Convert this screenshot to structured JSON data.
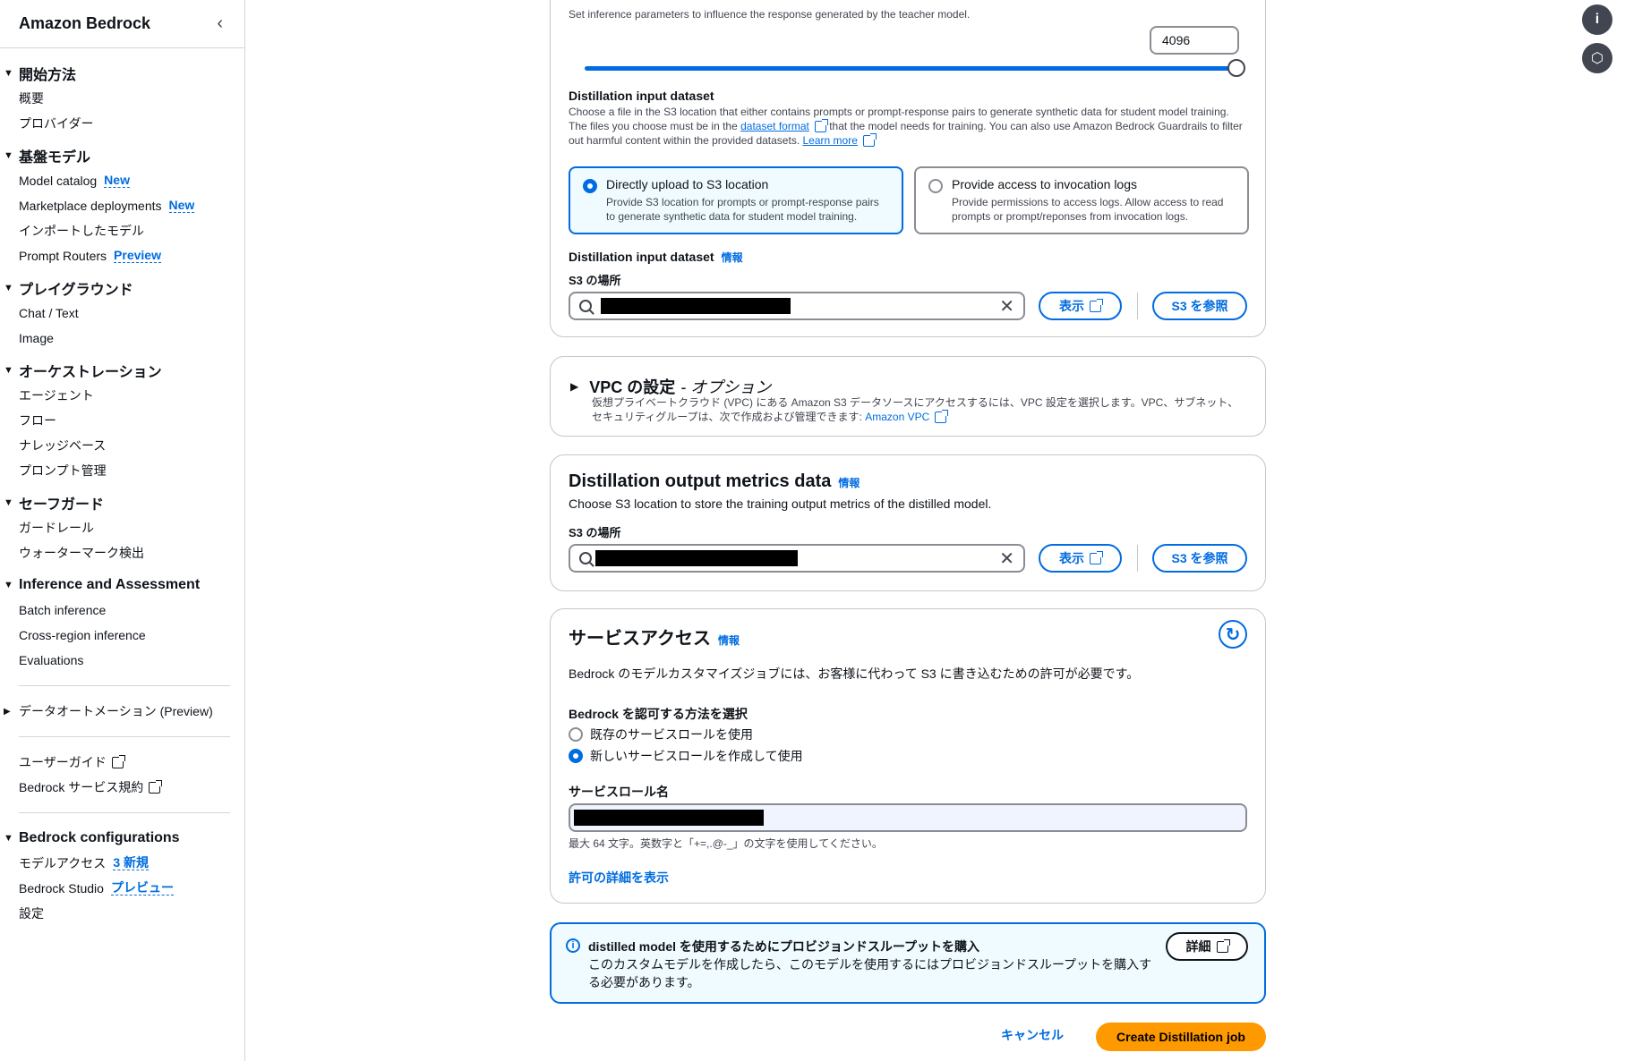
{
  "sidebar": {
    "title": "Amazon Bedrock",
    "sections": [
      {
        "title": "開始方法",
        "items": [
          {
            "label": "概要"
          },
          {
            "label": "プロバイダー"
          }
        ]
      },
      {
        "title": "基盤モデル",
        "items": [
          {
            "label": "Model catalog",
            "badge": "New"
          },
          {
            "label": "Marketplace deployments",
            "badge": "New"
          },
          {
            "label": "インポートしたモデル"
          },
          {
            "label": "Prompt Routers",
            "badge": "Preview"
          }
        ]
      },
      {
        "title": "プレイグラウンド",
        "items": [
          {
            "label": "Chat / Text"
          },
          {
            "label": "Image"
          }
        ]
      },
      {
        "title": "オーケストレーション",
        "items": [
          {
            "label": "エージェント"
          },
          {
            "label": "フロー"
          },
          {
            "label": "ナレッジベース"
          },
          {
            "label": "プロンプト管理"
          }
        ]
      },
      {
        "title": "セーフガード",
        "items": [
          {
            "label": "ガードレール"
          },
          {
            "label": "ウォーターマーク検出"
          }
        ]
      },
      {
        "title": "Inference and Assessment",
        "items": [
          {
            "label": "Batch inference"
          },
          {
            "label": "Cross-region inference"
          },
          {
            "label": "Evaluations"
          }
        ]
      }
    ],
    "data_automation": "データオートメーション (Preview)",
    "user_guide": "ユーザーガイド",
    "terms": "Bedrock サービス規約",
    "config": {
      "title": "Bedrock configurations",
      "model_access": "モデルアクセス",
      "model_access_badge": "3 新規",
      "studio": "Bedrock Studio",
      "studio_badge": "プレビュー",
      "settings": "設定"
    }
  },
  "top_card": {
    "desc": "Set inference parameters to influence the response generated by the teacher model.",
    "max_value": "4096",
    "slider_fraction": 1.0,
    "dataset_title": "Distillation input dataset",
    "dataset_desc_1": "Choose a file in the S3 location that either contains prompts or prompt-response pairs to generate synthetic data for student model training. The files you choose must be in the",
    "dataset_format_link": "dataset format",
    "dataset_desc_2": "that the model needs for training. You can also use Amazon Bedrock Guardrails to filter out harmful content within the provided datasets.",
    "learn_more": "Learn more",
    "tile1_title": "Directly upload to S3 location",
    "tile1_desc": "Provide S3 location for prompts or prompt-response pairs to generate synthetic data for student model training.",
    "tile2_title": "Provide access to invocation logs",
    "tile2_desc": "Provide permissions to access logs. Allow access to read prompts or prompt/reponses from invocation logs.",
    "input_label": "Distillation input dataset",
    "info": "情報",
    "s3_label": "S3 の場所",
    "view_btn": "表示",
    "browse_btn": "S3 を参照"
  },
  "vpc": {
    "title": "VPC の設定",
    "optional": "- オプション",
    "desc": "仮想プライベートクラウド (VPC) にある Amazon S3 データソースにアクセスするには、VPC 設定を選択します。VPC、サブネット、セキュリティグループは、次で作成および管理できます:",
    "link": "Amazon VPC"
  },
  "output": {
    "title": "Distillation output metrics data",
    "info": "情報",
    "desc": "Choose S3 location to store the training output metrics of the distilled model.",
    "s3_label": "S3 の場所",
    "view_btn": "表示",
    "browse_btn": "S3 を参照"
  },
  "service": {
    "title": "サービスアクセス",
    "info": "情報",
    "desc": "Bedrock のモデルカスタマイズジョブには、お客様に代わって S3 に書き込むための許可が必要です。",
    "method_label": "Bedrock を認可する方法を選択",
    "opt_existing": "既存のサービスロールを使用",
    "opt_new": "新しいサービスロールを作成して使用",
    "role_label": "サービスロール名",
    "hint": "最大 64 文字。英数字と「+=,.@-_」の文字を使用してください。",
    "details_link": "許可の詳細を表示"
  },
  "flash": {
    "title": "distilled model を使用するためにプロビジョンドスループットを購入",
    "desc": "このカスタムモデルを作成したら、このモデルを使用するにはプロビジョンドスループットを購入する必要があります。",
    "btn": "詳細"
  },
  "footer": {
    "cancel": "キャンセル",
    "create": "Create Distillation job"
  }
}
